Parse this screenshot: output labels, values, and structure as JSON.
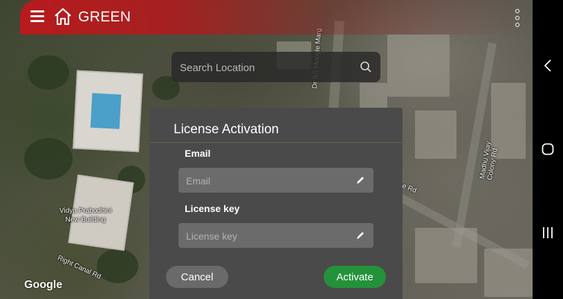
{
  "app": {
    "title": "GREEN",
    "brand_color": "#c0181c"
  },
  "search": {
    "placeholder": "Search Location"
  },
  "map": {
    "labels": {
      "road1": "Dr SS Moogle Marg",
      "road2": "Madhu Vijay Colony Rd",
      "road3": "Right Canal Rd",
      "road4": "e Rd",
      "building": "Vidya Prabodhini\nNew Building"
    },
    "attribution": "Google"
  },
  "dialog": {
    "title": "License Activation",
    "email": {
      "label": "Email",
      "placeholder": "Email",
      "value": ""
    },
    "license": {
      "label": "License key",
      "placeholder": "License key",
      "value": ""
    },
    "cancel_label": "Cancel",
    "activate_label": "Activate",
    "activate_color": "#24923a"
  }
}
